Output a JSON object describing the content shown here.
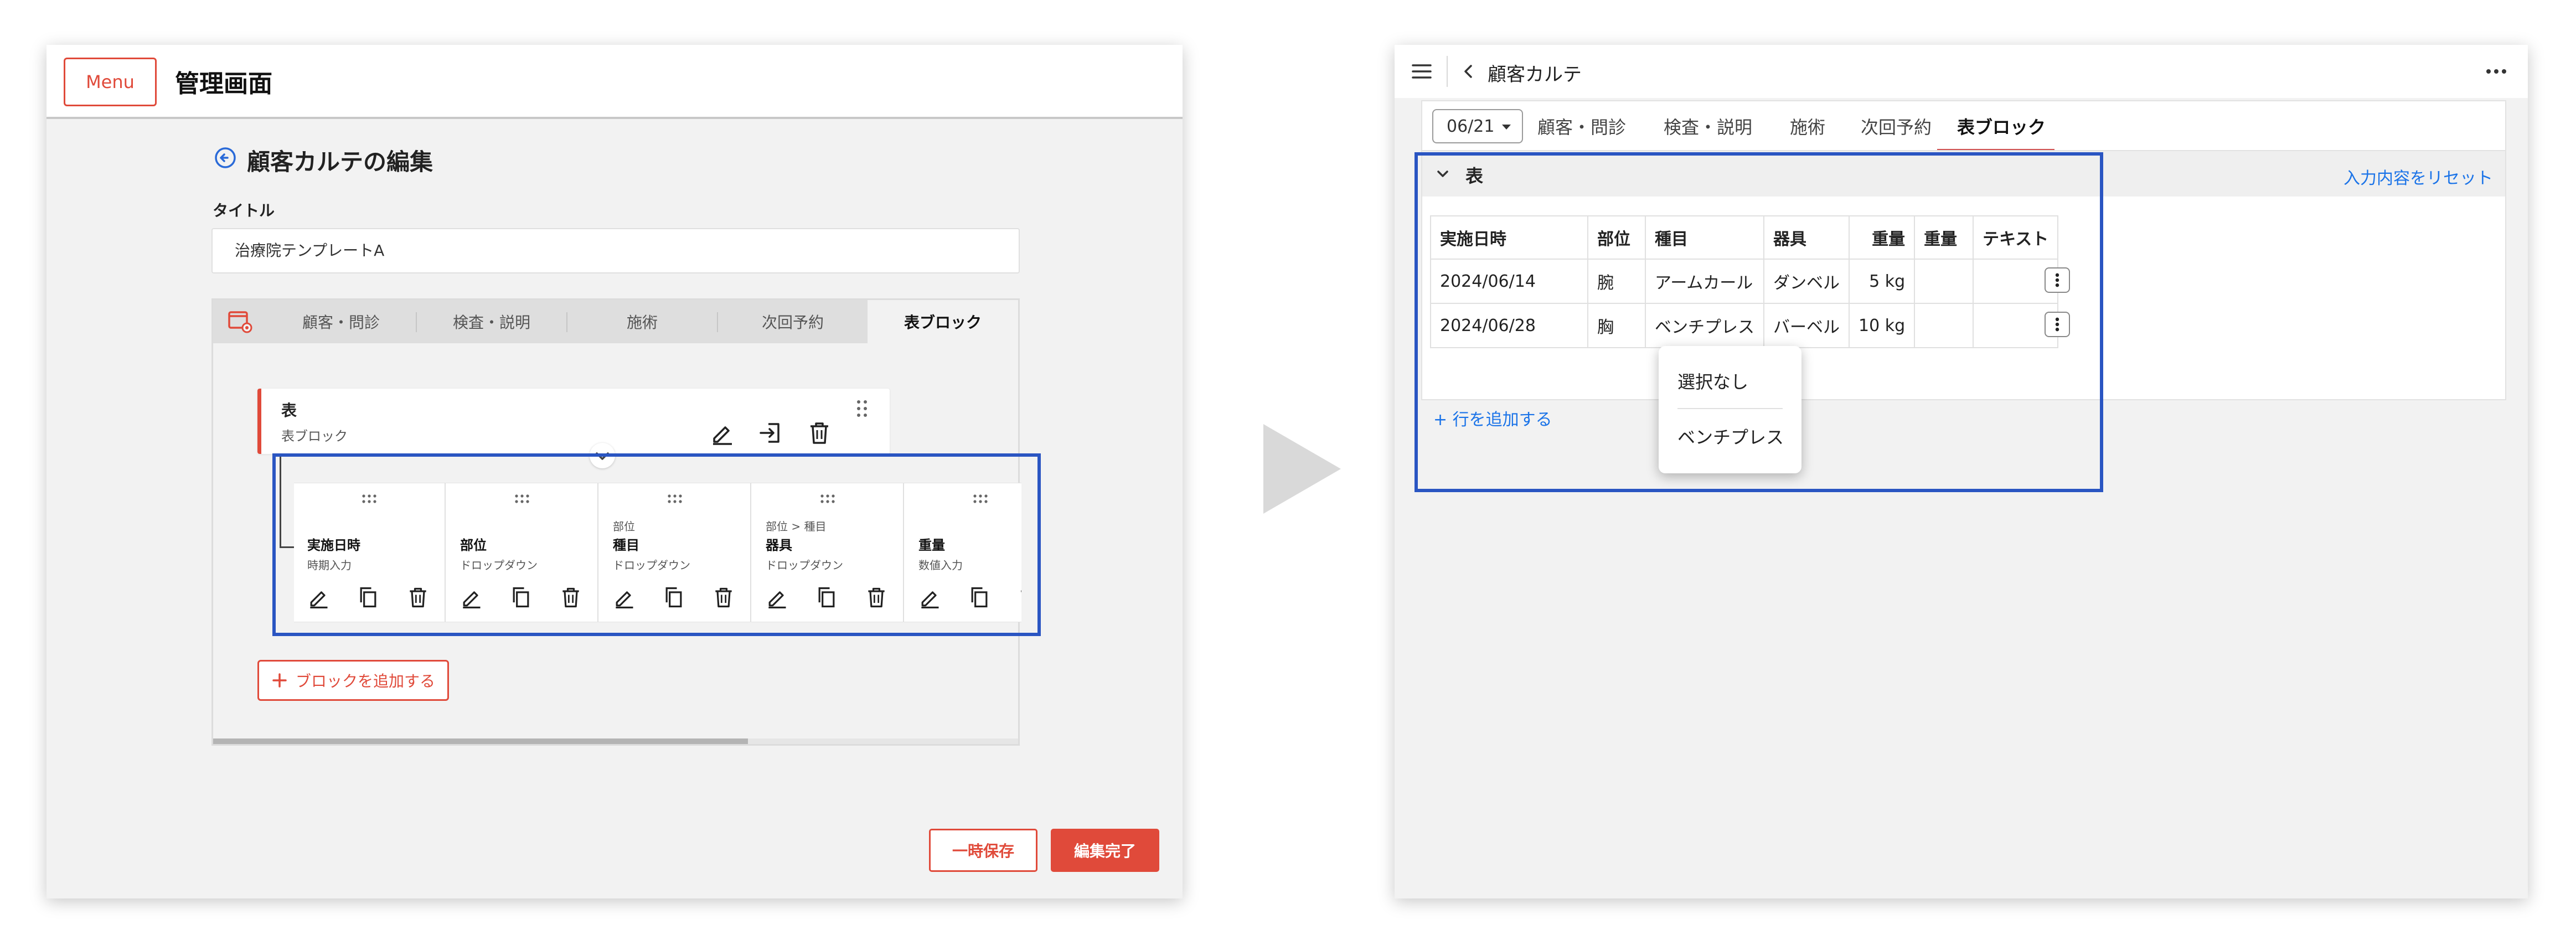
{
  "left": {
    "menu_label": "Menu",
    "app_title": "管理画面",
    "page_title": "顧客カルテの編集",
    "title_label": "タイトル",
    "title_value": "治療院テンプレートA",
    "tabs": [
      "顧客・問診",
      "検査・説明",
      "施術",
      "次回予約",
      "表ブロック"
    ],
    "block": {
      "name": "表",
      "type": "表ブロック"
    },
    "columns": [
      {
        "parent": "",
        "name": "実施日時",
        "type": "時期入力"
      },
      {
        "parent": "",
        "name": "部位",
        "type": "ドロップダウン"
      },
      {
        "parent": "部位",
        "name": "種目",
        "type": "ドロップダウン"
      },
      {
        "parent": "部位 > 種目",
        "name": "器具",
        "type": "ドロップダウン"
      },
      {
        "parent": "",
        "name": "重量",
        "type": "数値入力"
      }
    ],
    "add_block_label": "ブロックを追加する",
    "temp_save_label": "一時保存",
    "finish_label": "編集完了"
  },
  "right": {
    "screen_title": "顧客カルテ",
    "date_value": "06/21",
    "tabs": [
      "顧客・問診",
      "検査・説明",
      "施術",
      "次回予約",
      "表ブロック"
    ],
    "section_title": "表",
    "reset_label": "入力内容をリセット",
    "table": {
      "headers": [
        "実施日時",
        "部位",
        "種目",
        "器具",
        "重量",
        "重量",
        "テキスト"
      ],
      "rows": [
        [
          "2024/06/14",
          "腕",
          "アームカール",
          "ダンベル",
          "5 kg",
          "",
          ""
        ],
        [
          "2024/06/28",
          "胸",
          "ベンチプレス",
          "バーベル",
          "10 kg",
          "",
          ""
        ]
      ]
    },
    "add_row_label": "+ 行を追加する",
    "dropdown_options": [
      "選択なし",
      "ベンチプレス"
    ]
  },
  "colors": {
    "accent_red": "#e04a3a",
    "link_blue": "#1a73e8",
    "highlight_blue": "#2a55c2"
  }
}
